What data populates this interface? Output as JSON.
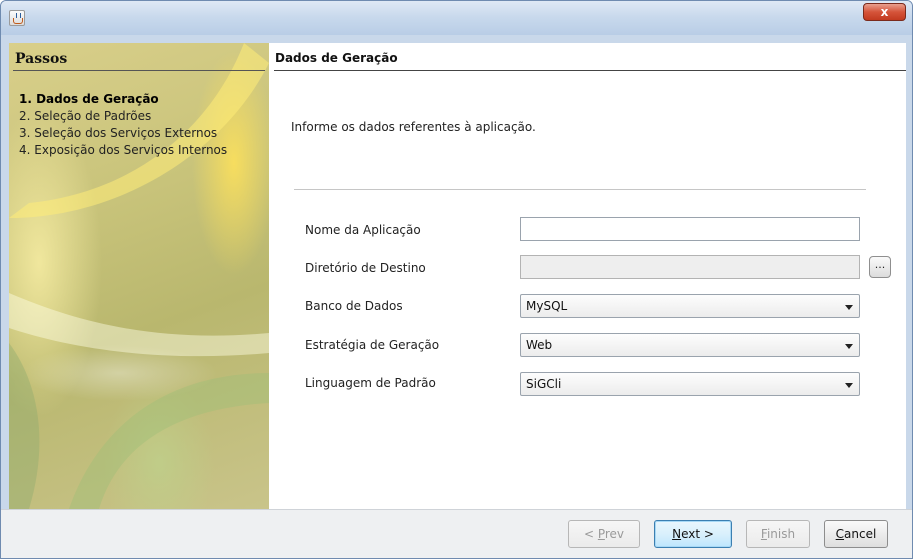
{
  "window": {
    "icon": "java-cup-icon",
    "close_label": "x",
    "colors": {
      "titlebar": "#c9d8ea",
      "close": "#d5543a"
    }
  },
  "sidebar": {
    "heading": "Passos",
    "steps": [
      {
        "label": "1. Dados de Geração",
        "active": true
      },
      {
        "label": "2. Seleção de Padrões",
        "active": false
      },
      {
        "label": "3. Seleção dos Serviços Externos",
        "active": false
      },
      {
        "label": "4. Exposição dos Serviços Internos",
        "active": false
      }
    ]
  },
  "panel": {
    "title": "Dados de Geração",
    "intro": "Informe os dados referentes à aplicação."
  },
  "form": {
    "nome_label": "Nome da Aplicação",
    "nome_value": "",
    "diretorio_label": "Diretório de Destino",
    "diretorio_value": "",
    "browse_label": "...",
    "banco_label": "Banco de Dados",
    "banco_value": "MySQL",
    "estrategia_label": "Estratégia de Geração",
    "estrategia_value": "Web",
    "linguagem_label": "Linguagem de Padrão",
    "linguagem_value": "SiGCli"
  },
  "buttons": {
    "prev_pre": "< ",
    "prev_mn": "P",
    "prev_rest": "rev",
    "next_mn": "N",
    "next_rest": "ext >",
    "finish_mn": "F",
    "finish_rest": "inish",
    "cancel_mn": "C",
    "cancel_rest": "ancel"
  }
}
